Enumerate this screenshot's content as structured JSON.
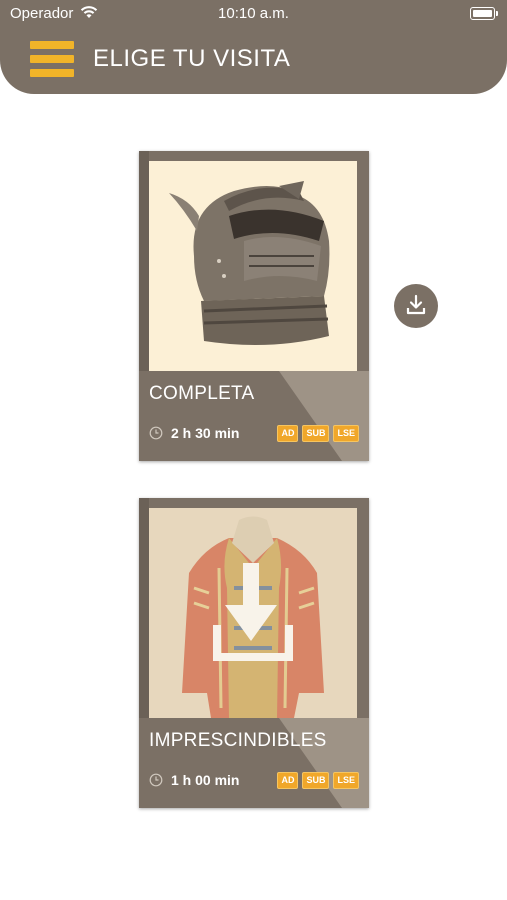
{
  "status_bar": {
    "carrier": "Operador",
    "time": "10:10 a.m."
  },
  "header": {
    "title": "ELIGE TU VISITA"
  },
  "tours": [
    {
      "title": "COMPLETA",
      "duration": "2 h 30 min",
      "badges": [
        "AD",
        "SUB",
        "LSE"
      ],
      "image_icon": "armor-helmet-image",
      "downloaded": false
    },
    {
      "title": "IMPRESCINDIBLES",
      "duration": "1 h 00 min",
      "badges": [
        "AD",
        "SUB",
        "LSE"
      ],
      "image_icon": "hussar-jacket-image",
      "download_overlay_icon": "download-arrow-icon"
    }
  ],
  "colors": {
    "header_bg": "#7b7065",
    "accent": "#f1b429",
    "badge": "#f0a72a"
  }
}
